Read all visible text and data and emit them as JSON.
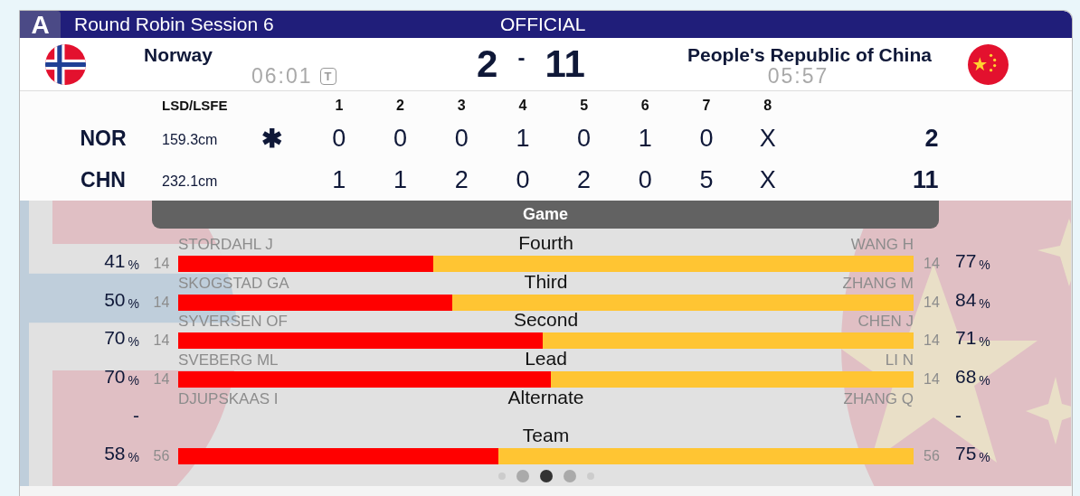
{
  "header": {
    "badge": "A",
    "title": "Round Robin Session 6",
    "status": "OFFICIAL"
  },
  "home": {
    "name": "Norway",
    "clock": "06:01",
    "timeout_badge": "T",
    "score": "2",
    "kind": "norway"
  },
  "score_separator": "-",
  "away": {
    "name": "People's Republic of China",
    "clock": "05:57",
    "score": "11",
    "kind": "china"
  },
  "linescore": {
    "lsd_header": "LSD/LSFE",
    "end_headers": [
      "1",
      "2",
      "3",
      "4",
      "5",
      "6",
      "7",
      "8"
    ],
    "rows": [
      {
        "team": "NOR",
        "lsd": "159.3cm",
        "hammer": "✱",
        "ends": [
          "0",
          "0",
          "0",
          "1",
          "0",
          "1",
          "0",
          "X"
        ],
        "total": "2"
      },
      {
        "team": "CHN",
        "lsd": "232.1cm",
        "ends": [
          "1",
          "1",
          "2",
          "0",
          "2",
          "0",
          "5",
          "X"
        ],
        "total": "11"
      }
    ]
  },
  "stats": {
    "tab": "Game",
    "rows": [
      {
        "position": "Fourth",
        "home_player": "STORDAHL J",
        "away_player": "WANG H",
        "home_count": "14",
        "away_count": "14",
        "home_pct": "41",
        "away_pct": "77",
        "unit": "%",
        "level": 0.347
      },
      {
        "position": "Third",
        "home_player": "SKOGSTAD GA",
        "away_player": "ZHANG M",
        "home_count": "14",
        "away_count": "14",
        "home_pct": "50",
        "away_pct": "84",
        "unit": "%",
        "level": 0.373
      },
      {
        "position": "Second",
        "home_player": "SYVERSEN OF",
        "away_player": "CHEN J",
        "home_count": "14",
        "away_count": "14",
        "home_pct": "70",
        "away_pct": "71",
        "unit": "%",
        "level": 0.496
      },
      {
        "position": "Lead",
        "home_player": "SVEBERG ML",
        "away_player": "LI N",
        "home_count": "14",
        "away_count": "14",
        "home_pct": "70",
        "away_pct": "68",
        "unit": "%",
        "level": 0.507
      },
      {
        "position": "Alternate",
        "home_player": "DJUPSKAAS I",
        "away_player": "ZHANG Q",
        "home_pct": "-",
        "away_pct": "-"
      },
      {
        "position": "Team",
        "home_count": "56",
        "away_count": "56",
        "home_pct": "58",
        "away_pct": "75",
        "unit": "%",
        "level": 0.436
      }
    ]
  },
  "pages": [
    {
      "selected": false
    },
    {
      "selected": false
    },
    {
      "selected": true
    },
    {
      "selected": false
    },
    {
      "selected": false
    }
  ]
}
